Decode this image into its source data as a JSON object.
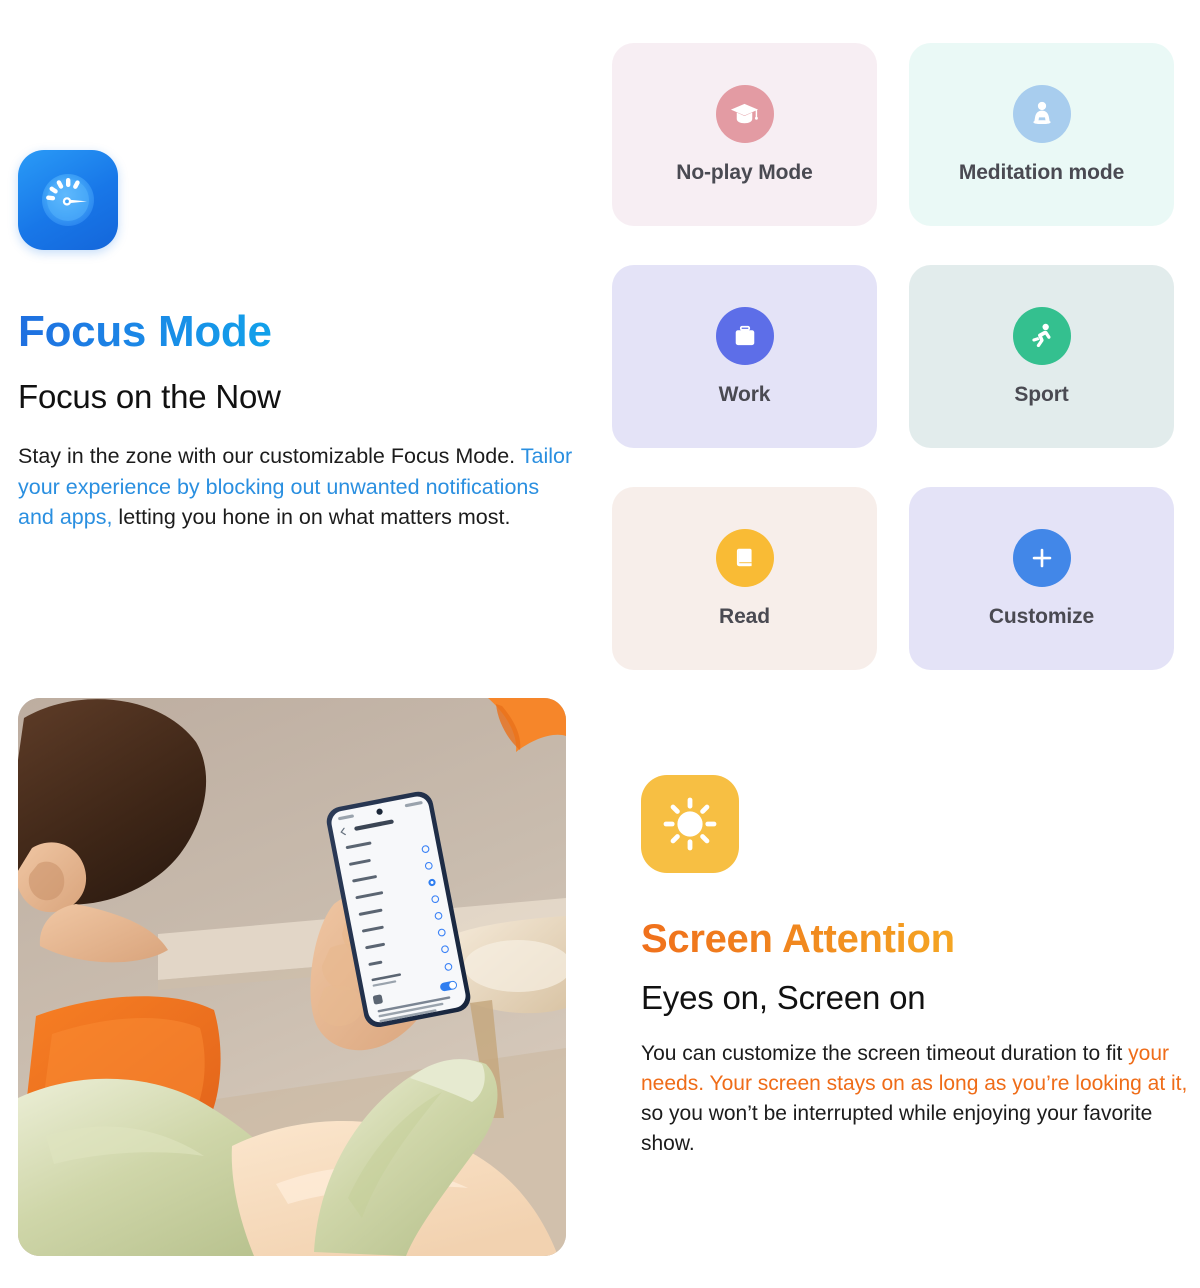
{
  "focus_section": {
    "app_icon_name": "speedometer-gauge-icon",
    "headline": "Focus Mode",
    "subheadline": "Focus on the Now",
    "body": {
      "lead": "Stay in the zone with our customizable Focus Mode. ",
      "highlight": "Tailor your experience by blocking out unwanted notifications and apps,",
      "tail": " letting you hone in on what matters most."
    },
    "accent_color": "#1f6fe0",
    "accent_color_end": "#12a2ea",
    "highlight_color": "#2a8fe0"
  },
  "mode_grid": {
    "cards": [
      {
        "label": "No-play Mode",
        "icon": "graduation-cap-icon",
        "card_bg": "#f7eef3",
        "badge_bg": "#e39ba3"
      },
      {
        "label": "Meditation mode",
        "icon": "meditation-person-icon",
        "card_bg": "#eaf9f6",
        "badge_bg": "#a8cdee"
      },
      {
        "label": "Work",
        "icon": "briefcase-icon",
        "card_bg": "#e4e3f7",
        "badge_bg": "#5d6ee8"
      },
      {
        "label": "Sport",
        "icon": "running-person-icon",
        "card_bg": "#e2ecec",
        "badge_bg": "#34c08f"
      },
      {
        "label": "Read",
        "icon": "book-icon",
        "card_bg": "#f7eeea",
        "badge_bg": "#f9bb35"
      },
      {
        "label": "Customize",
        "icon": "plus-icon",
        "card_bg": "#e4e3f7",
        "badge_bg": "#4287e8"
      }
    ]
  },
  "photo": {
    "name": "person-using-phone-photo",
    "alt": "Young man seen from behind reclining in an orange chair, holding a smartphone that displays a screen-timeout settings list with radio options and a toggle switch"
  },
  "attention_section": {
    "icon_name": "sun-brightness-icon",
    "headline": "Screen Attention",
    "subheadline": "Eyes on, Screen on",
    "body": {
      "lead": "You can customize the screen timeout duration to fit ",
      "highlight": "your needs. Your screen stays on as long as you’re looking at it,",
      "tail": " so you won’t be interrupted while enjoying your favorite show."
    },
    "accent_color": "#f0701c",
    "accent_color_end": "#f5a623",
    "highlight_color": "#ef6c18",
    "icon_bg": "#f7bf43"
  }
}
